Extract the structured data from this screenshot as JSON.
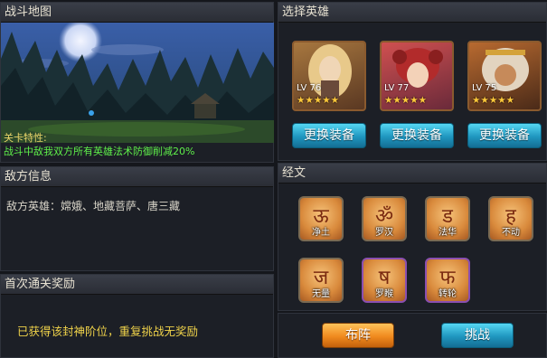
{
  "battle_map": {
    "title": "战斗地图",
    "feature_title": "关卡特性:",
    "feature_text": "战斗中敌我双方所有英雄法术防御削减20%"
  },
  "enemy_info": {
    "title": "敌方信息",
    "text": "敌方英雄：嫦娥、地藏菩萨、唐三藏"
  },
  "first_clear": {
    "title": "首次通关奖励",
    "text": "已获得该封神阶位，重复挑战无奖励"
  },
  "hero_select": {
    "title": "选择英雄",
    "heroes": [
      {
        "level": "LV 76",
        "stars": "★★★★★",
        "button": "更换装备",
        "icon": "hero-portrait-blonde"
      },
      {
        "level": "LV 77",
        "stars": "★★★★★",
        "button": "更换装备",
        "icon": "hero-portrait-red-hair"
      },
      {
        "level": "LV 75",
        "stars": "★★★★★",
        "button": "更换装备",
        "icon": "hero-portrait-monkey"
      }
    ]
  },
  "sutras": {
    "title": "经文",
    "items": [
      {
        "label": "净土",
        "icon": "sanskrit-glyph-icon"
      },
      {
        "label": "罗汉",
        "icon": "sanskrit-glyph-icon"
      },
      {
        "label": "法华",
        "icon": "sanskrit-glyph-icon"
      },
      {
        "label": "不动",
        "icon": "sanskrit-glyph-icon"
      },
      {
        "label": "无量",
        "icon": "sanskrit-glyph-icon"
      },
      {
        "label": "罗睺",
        "icon": "sanskrit-glyph-icon"
      },
      {
        "label": "转轮",
        "icon": "sanskrit-glyph-icon"
      }
    ]
  },
  "actions": {
    "formation": "布阵",
    "challenge": "挑战"
  },
  "colors": {
    "feature_title": "#e9d469",
    "feature_text": "#5ff04a",
    "reward_text": "#f0d34a",
    "button_blue": "#1f96bf",
    "button_orange": "#f08a1e"
  }
}
